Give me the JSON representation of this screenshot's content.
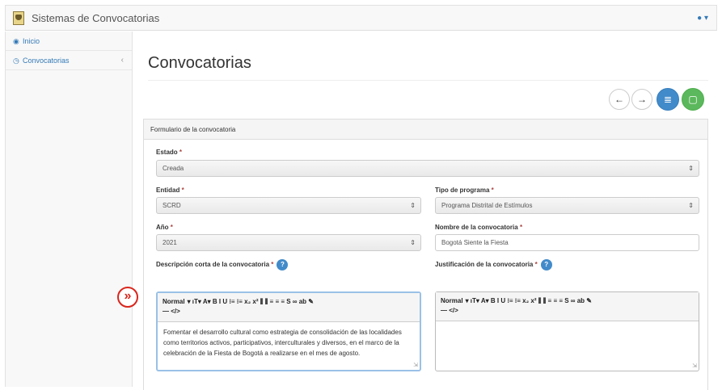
{
  "app": {
    "title": "Sistemas de Convocatorias"
  },
  "user_menu": {
    "icon": "user-icon",
    "caret": "▾"
  },
  "sidebar": {
    "items": [
      {
        "label": "Inicio",
        "icon": "dashboard-icon"
      },
      {
        "label": "Convocatorias",
        "icon": "clipboard-icon",
        "chevron": "‹"
      }
    ]
  },
  "page": {
    "title": "Convocatorias"
  },
  "actions": {
    "back": "←",
    "forward": "→",
    "list": "≣",
    "new": "▢"
  },
  "form": {
    "panel_title": "Formulario de la convocatoria",
    "required_mark": "*",
    "estado": {
      "label": "Estado",
      "value": "Creada"
    },
    "entidad": {
      "label": "Entidad",
      "value": "SCRD"
    },
    "tipo_programa": {
      "label": "Tipo de programa",
      "value": "Programa Distrital de Estímulos"
    },
    "anio": {
      "label": "Año",
      "value": "2021"
    },
    "nombre": {
      "label": "Nombre de la convocatoria",
      "value": "Bogotá Siente la Fiesta"
    },
    "descripcion": {
      "label": "Descripción corta de la convocatoria",
      "value": "Fomentar el desarrollo cultural como estrategia de consolidación de las localidades como territorios activos, participativos, interculturales y diversos, en el marco de la celebración de la Fiesta de Bogotá a realizarse en el mes de agosto."
    },
    "justificacion": {
      "label": "Justificación de la convocatoria",
      "value": ""
    },
    "help_label": "?"
  },
  "editor_toolbar": {
    "style": "Normal",
    "buttons_row1": "▾ ıT▾ A▾ B I U ⁝≡ ⁝≡ x₂ x² ⫼ ⫼ ≡ ≡ ≡ S ∞ ab ✎",
    "buttons_row2": "— </>"
  },
  "marker": {
    "symbol": "»"
  },
  "colors": {
    "primary": "#428bca",
    "success": "#5cb85c",
    "required": "#a94442",
    "marker": "#d9261c"
  }
}
